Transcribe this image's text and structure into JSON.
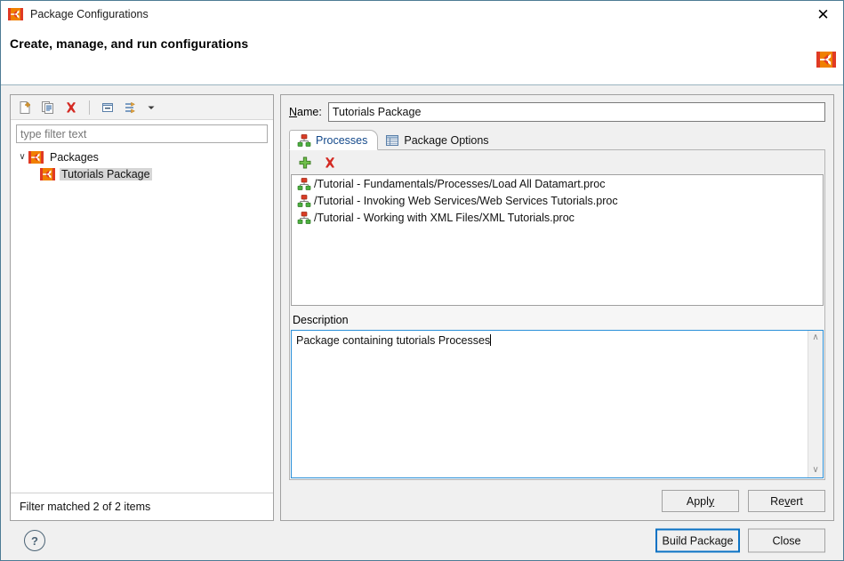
{
  "window": {
    "title": "Package Configurations",
    "close_label": "✕",
    "app_icon": "webmethods-logo-icon"
  },
  "banner": {
    "heading": "Create, manage, and run configurations",
    "logo": "webmethods-logo-icon"
  },
  "left_pane": {
    "toolbar": [
      {
        "name": "new-configuration-icon",
        "tooltip": "New"
      },
      {
        "name": "duplicate-configuration-icon",
        "tooltip": "Duplicate"
      },
      {
        "name": "delete-configuration-icon",
        "tooltip": "Delete"
      },
      {
        "name": "collapse-all-icon",
        "tooltip": "Collapse All"
      },
      {
        "name": "filter-configurations-icon",
        "tooltip": "Filter"
      },
      {
        "name": "chevron-down-icon",
        "tooltip": "Menu"
      }
    ],
    "filter": {
      "value": "",
      "placeholder": "type filter text"
    },
    "tree": [
      {
        "label": "Packages",
        "icon": "package-icon",
        "expanded": true,
        "selected": false,
        "chevron": "∨"
      },
      {
        "label": "Tutorials Package",
        "icon": "package-icon",
        "expanded": false,
        "selected": true,
        "chevron": ""
      }
    ],
    "status": "Filter matched 2 of 2 items"
  },
  "right_pane": {
    "name_label": "Name:",
    "name_mnemonic": "N",
    "name_value": "Tutorials Package",
    "tabs": [
      {
        "label": "Processes",
        "icon": "process-tree-icon",
        "active": true
      },
      {
        "label": "Package Options",
        "icon": "options-table-icon",
        "active": false
      }
    ],
    "processes_toolbar": [
      {
        "name": "add-process-icon",
        "label": "+"
      },
      {
        "name": "remove-process-icon",
        "label": "✖"
      }
    ],
    "processes": [
      {
        "icon": "process-tree-icon",
        "path": "/Tutorial - Fundamentals/Processes/Load All Datamart.proc"
      },
      {
        "icon": "process-tree-icon",
        "path": "/Tutorial - Invoking Web Services/Web Services Tutorials.proc"
      },
      {
        "icon": "process-tree-icon",
        "path": "/Tutorial - Working with XML Files/XML Tutorials.proc"
      }
    ],
    "description_label": "Description",
    "description_value": "Package containing tutorials Processes",
    "scrollbar": {
      "up": "∧",
      "down": "∨"
    },
    "apply_label": "Apply",
    "apply_mnemonic": "y",
    "revert_label": "Revert",
    "revert_mnemonic": "v"
  },
  "footer": {
    "help_label": "?",
    "build_label": "Build Package",
    "close_label": "Close"
  },
  "colors": {
    "window_border": "#4d7b94",
    "accent_blue": "#0a72c4",
    "tab_active_text": "#13498b",
    "logo_orange": "#f08000",
    "logo_red": "#e03a24",
    "focus_border": "#2b90d9",
    "selection_gray": "#d6d6d6"
  }
}
